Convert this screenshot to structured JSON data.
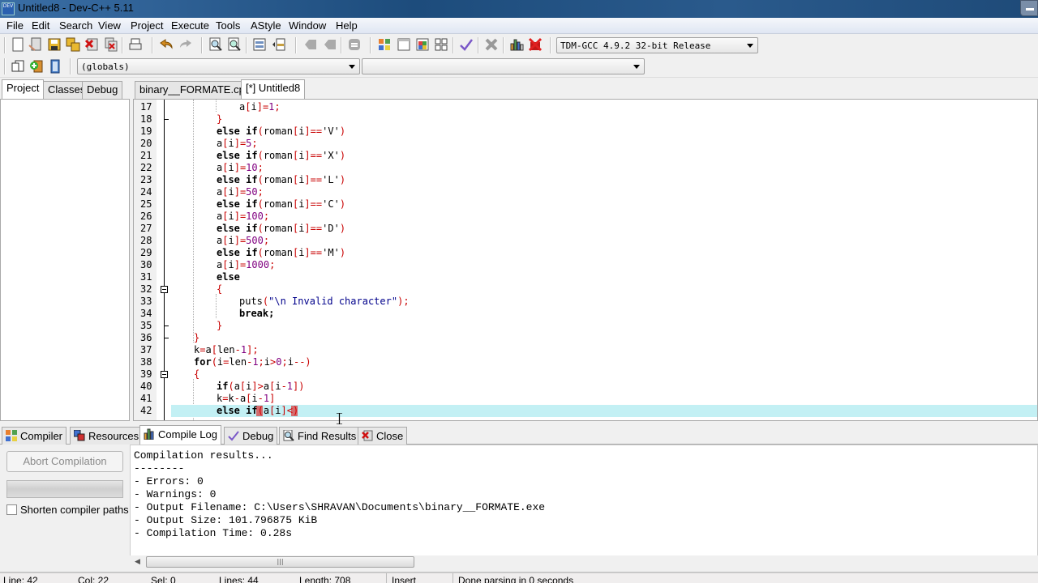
{
  "window": {
    "title": "Untitled8 - Dev-C++ 5.11",
    "app_icon": "DEV"
  },
  "menu": [
    "File",
    "Edit",
    "Search",
    "View",
    "Project",
    "Execute",
    "Tools",
    "AStyle",
    "Window",
    "Help"
  ],
  "toolbar": {
    "compiler_select": "TDM-GCC 4.9.2 32-bit Release",
    "scope_select": "(globals)",
    "function_select": ""
  },
  "left_tabs": [
    "Project",
    "Classes",
    "Debug"
  ],
  "editor_tabs": [
    "binary__FORMATE.cpp",
    "[*] Untitled8"
  ],
  "code_lines": [
    {
      "n": "17"
    },
    {
      "n": "18"
    },
    {
      "n": "19"
    },
    {
      "n": "20"
    },
    {
      "n": "21"
    },
    {
      "n": "22"
    },
    {
      "n": "23"
    },
    {
      "n": "24"
    },
    {
      "n": "25"
    },
    {
      "n": "26"
    },
    {
      "n": "27"
    },
    {
      "n": "28"
    },
    {
      "n": "29"
    },
    {
      "n": "30"
    },
    {
      "n": "31"
    },
    {
      "n": "32"
    },
    {
      "n": "33"
    },
    {
      "n": "34"
    },
    {
      "n": "35"
    },
    {
      "n": "36"
    },
    {
      "n": "37"
    },
    {
      "n": "38"
    },
    {
      "n": "39"
    },
    {
      "n": "40"
    },
    {
      "n": "41"
    },
    {
      "n": "42"
    }
  ],
  "code_text": {
    "l17": "a[i]=1;",
    "l18": "}",
    "l19": "else if(roman[i]=='V')",
    "l20": "a[i]=5;",
    "l21": "else if(roman[i]=='X')",
    "l22": "a[i]=10;",
    "l23": "else if(roman[i]=='L')",
    "l24": "a[i]=50;",
    "l25": "else if(roman[i]=='C')",
    "l26": "a[i]=100;",
    "l27": "else if(roman[i]=='D')",
    "l28": "a[i]=500;",
    "l29": "else if(roman[i]=='M')",
    "l30": "a[i]=1000;",
    "l31": "else",
    "l32": "{",
    "l33": "puts(\"\\n Invalid character\");",
    "l34": "break;",
    "l35": "}",
    "l36": "}",
    "l37": "k=a[len-1];",
    "l38": "for(i=len-1;i>0;i--)",
    "l39": "{",
    "l40": "if(a[i]>a[i-1])",
    "l41": "k=k-a[i-1]",
    "l42": "else if(a[i]<)"
  },
  "bottom_tabs": [
    "Compiler",
    "Resources",
    "Compile Log",
    "Debug",
    "Find Results",
    "Close"
  ],
  "compile_panel": {
    "abort_label": "Abort Compilation",
    "shorten_label": "Shorten compiler paths",
    "shorten_checked": false,
    "log": [
      "Compilation results...",
      "--------",
      "- Errors: 0",
      "- Warnings: 0",
      "- Output Filename: C:\\Users\\SHRAVAN\\Documents\\binary__FORMATE.exe",
      "- Output Size: 101.796875 KiB",
      "- Compilation Time: 0.28s"
    ]
  },
  "status": {
    "line": "Line:   42",
    "col": "Col:   22",
    "sel": "Sel:   0",
    "lines": "Lines:   44",
    "length": "Length:   708",
    "mode": "Insert",
    "message": "Done parsing in 0 seconds"
  }
}
